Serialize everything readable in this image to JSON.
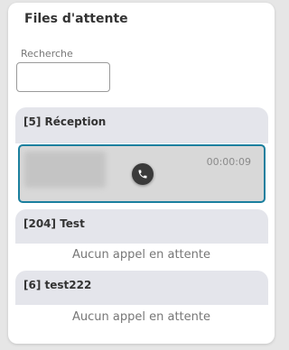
{
  "panel": {
    "title": "Files d'attente",
    "search": {
      "label": "Recherche",
      "value": "",
      "placeholder": ""
    }
  },
  "queues": [
    {
      "name": "[5] Réception",
      "calls": [
        {
          "timer": "00:00:09",
          "icon": "phone-icon"
        }
      ]
    },
    {
      "name": "[204] Test",
      "empty_message": "Aucun appel en attente"
    },
    {
      "name": "[6] test222",
      "empty_message": "Aucun appel en attente"
    }
  ],
  "colors": {
    "background": "#e6e6e6",
    "panel": "#ffffff",
    "queue_header": "#e4e5eb",
    "call_card": "#d8d8d8",
    "call_card_border": "#1a7f9e",
    "icon": "#3a3a3a"
  }
}
